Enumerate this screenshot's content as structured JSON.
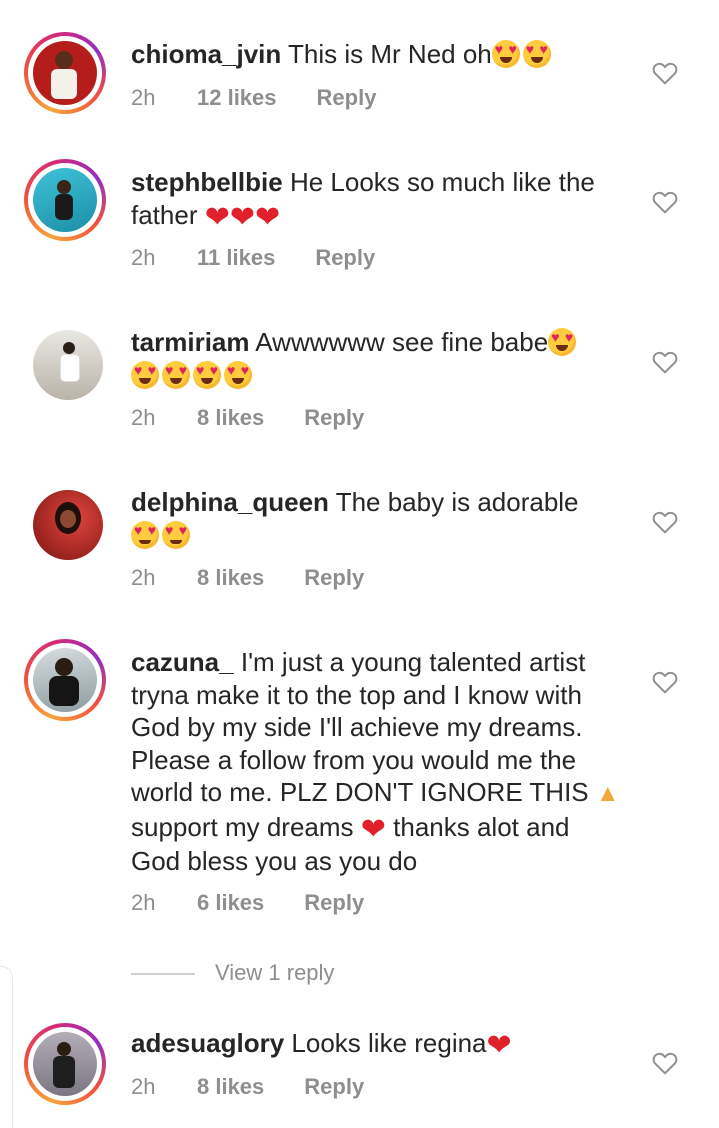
{
  "comments": [
    {
      "username": "chioma_jvin",
      "text": "This is Mr Ned oh",
      "emojis": [
        "heart-eyes",
        "heart-eyes"
      ],
      "time": "2h",
      "likes": "12 likes",
      "reply": "Reply"
    },
    {
      "username": "stephbellbie",
      "text": "He Looks so much like the father",
      "emojis": [
        "red-heart",
        "red-heart",
        "red-heart"
      ],
      "time": "2h",
      "likes": "11 likes",
      "reply": "Reply"
    },
    {
      "username": "tarmiriam",
      "text": "Awwwwww see fine babe",
      "emojis": [
        "heart-eyes",
        "heart-eyes",
        "heart-eyes",
        "heart-eyes",
        "heart-eyes"
      ],
      "time": "2h",
      "likes": "8 likes",
      "reply": "Reply"
    },
    {
      "username": "delphina_queen",
      "text": "The baby is adorable",
      "emojis": [
        "smiling-face-with-hearts",
        "smiling-face-with-hearts"
      ],
      "time": "2h",
      "likes": "8 likes",
      "reply": "Reply"
    },
    {
      "username": "cazuna_",
      "text_part1": "I'm just a young talented artist tryna make it to the top and I know with God by my side I'll achieve my dreams. Please a follow from you would me the world to me. PLZ DON'T IGNORE THIS",
      "text_part2": "support my dreams",
      "text_part3": "thanks alot and God bless you as you do",
      "emojis": [
        "folded-hands",
        "red-heart"
      ],
      "time": "2h",
      "likes": "6 likes",
      "reply": "Reply"
    },
    {
      "username": "adesuaglory",
      "text": "Looks like regina",
      "emojis": [
        "red-heart"
      ],
      "time": "2h",
      "likes": "8 likes",
      "reply": "Reply"
    }
  ],
  "view_replies_label": "View 1 reply",
  "icons": {
    "like": "heart-outline-icon"
  },
  "colors": {
    "text": "#262626",
    "meta": "#8e8e8e",
    "story_ring_start": "#f9a33b",
    "story_ring_end": "#962fbf"
  }
}
